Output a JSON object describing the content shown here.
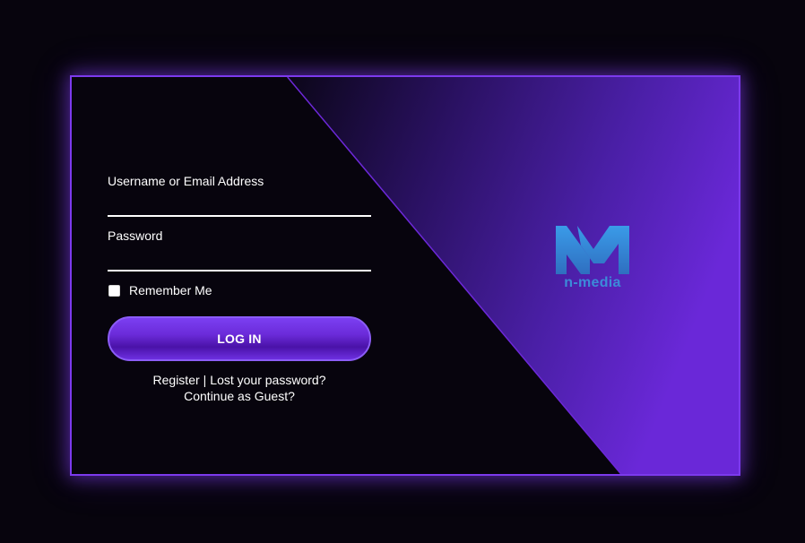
{
  "form": {
    "username_label": "Username or Email Address",
    "username_value": "",
    "password_label": "Password",
    "password_value": "",
    "remember_label": "Remember Me",
    "remember_checked": false,
    "login_button": "LOG IN"
  },
  "links": {
    "register": "Register",
    "separator": "|",
    "lost_password": "Lost your password?",
    "guest": "Continue as Guest?"
  },
  "brand": {
    "logo_icon": "n-media-logo-icon",
    "logo_text": "n-media",
    "logo_color": "#3c8bd9"
  },
  "colors": {
    "accent": "#7c3aed",
    "background": "#07040d",
    "text": "#ffffff"
  }
}
